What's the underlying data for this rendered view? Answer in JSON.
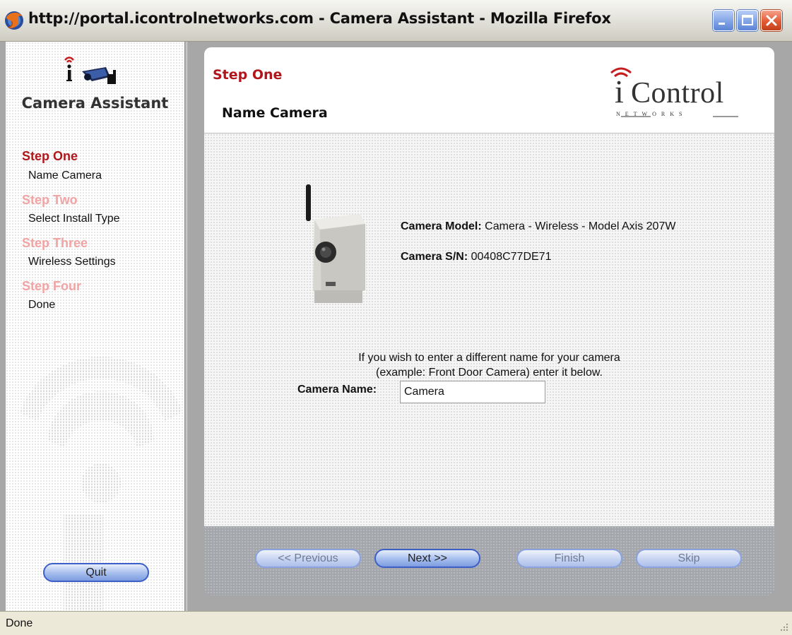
{
  "window": {
    "title": "http://portal.icontrolnetworks.com - Camera Assistant - Mozilla Firefox"
  },
  "sidebar": {
    "title": "Camera Assistant",
    "steps": [
      {
        "label": "Step One",
        "sublabel": "Name Camera",
        "state": "active"
      },
      {
        "label": "Step Two",
        "sublabel": "Select Install Type",
        "state": "inactive"
      },
      {
        "label": "Step Three",
        "sublabel": "Wireless Settings",
        "state": "inactive"
      },
      {
        "label": "Step Four",
        "sublabel": "Done",
        "state": "inactive"
      }
    ],
    "quit_label": "Quit"
  },
  "header": {
    "step": "Step One",
    "title": "Name Camera",
    "brand": {
      "initial": "i",
      "word": "Control",
      "tagline": "NETWORKS"
    }
  },
  "content": {
    "model_label": "Camera Model:",
    "model_value": "Camera - Wireless - Model Axis 207W",
    "sn_label": "Camera S/N:",
    "sn_value": "00408C77DE71",
    "instructions_line1": "If you wish to enter a different name for your camera",
    "instructions_line2": "(example: Front Door Camera) enter it below.",
    "name_label": "Camera Name:",
    "name_value": "Camera"
  },
  "footer": {
    "previous_label": "<< Previous",
    "next_label": "Next >>",
    "finish_label": "Finish",
    "skip_label": "Skip"
  },
  "status": {
    "text": "Done"
  },
  "colors": {
    "active_step": "#b0161b",
    "inactive_step": "#f0a4a4",
    "button_border": "#3d5fc8"
  }
}
